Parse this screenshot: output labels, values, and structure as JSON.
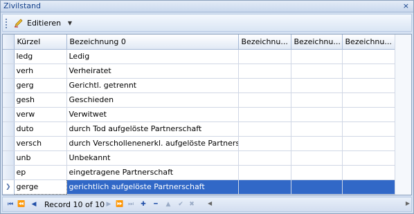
{
  "window": {
    "title": "Zivilstand",
    "close_glyph": "×"
  },
  "toolbar": {
    "edit_label": "Editieren",
    "edit_icon": "pencil-icon"
  },
  "grid": {
    "columns": [
      "Kürzel",
      "Bezeichnung 0",
      "Bezeichnu...",
      "Bezeichnu...",
      "Bezeichnu..."
    ],
    "rows": [
      {
        "code": "ledg",
        "name": "Ledig"
      },
      {
        "code": "verh",
        "name": "Verheiratet"
      },
      {
        "code": "gerg",
        "name": "Gerichtl. getrennt"
      },
      {
        "code": "gesh",
        "name": "Geschieden"
      },
      {
        "code": "verw",
        "name": "Verwitwet"
      },
      {
        "code": "duto",
        "name": "durch Tod aufgelöste Partnerschaft"
      },
      {
        "code": "versch",
        "name": "durch Verschollenenerkl. aufgelöste Partnerschaft"
      },
      {
        "code": "unb",
        "name": "Unbekannt"
      },
      {
        "code": "ep",
        "name": "eingetragene Partnerschaft"
      },
      {
        "code": "gerge",
        "name": "gerichtlich aufgelöste Partnerschaft"
      }
    ],
    "selected_row_index": 9
  },
  "navigator": {
    "record_text": "Record 10 of 10",
    "colors": {
      "selection": "#3168c7"
    }
  }
}
